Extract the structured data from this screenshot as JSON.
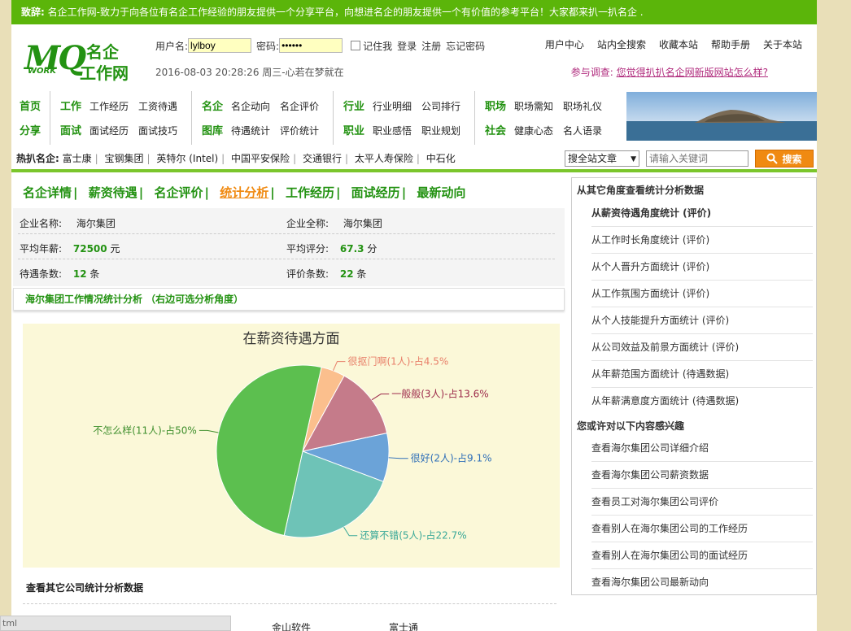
{
  "greeting": {
    "label": "致辞:",
    "text": " 名企工作网-致力于向各位有名企工作经验的朋友提供一个分享平台，向想进名企的朋友提供一个有价值的参考平台！大家都来扒一扒名企 ."
  },
  "logo": {
    "mq": "MQ",
    "work": "WORK",
    "cn1": "名企",
    "cn2": "工作网"
  },
  "login": {
    "user_label": "用户名:",
    "user_value": "lylboy",
    "pass_label": "密码:",
    "pass_value": "••••••",
    "remember": "记住我",
    "login": "登录",
    "register": "注册",
    "forgot": "忘记密码"
  },
  "datetime": "2016-08-03 20:28:26  周三-心若在梦就在",
  "topnav": [
    "用户中心",
    "站内全搜索",
    "收藏本站",
    "帮助手册",
    "关于本站"
  ],
  "survey": {
    "label": "参与调查:",
    "question": "您觉得扒扒名企网新版网站怎么样?"
  },
  "nav": {
    "g1": {
      "r1h": "首页",
      "r2h": "分享"
    },
    "g2": {
      "r1h": "工作",
      "r1": [
        "工作经历",
        "工资待遇"
      ],
      "r2h": "面试",
      "r2": [
        "面试经历",
        "面试技巧"
      ]
    },
    "g3": {
      "r1h": "名企",
      "r1": [
        "名企动向",
        "名企评价"
      ],
      "r2h": "图库",
      "r2": [
        "待遇统计",
        "评价统计"
      ]
    },
    "g4": {
      "r1h": "行业",
      "r1": [
        "行业明细",
        "公司排行"
      ],
      "r2h": "职业",
      "r2": [
        "职业感悟",
        "职业规划"
      ]
    },
    "g5": {
      "r1h": "职场",
      "r1": [
        "职场需知",
        "职场礼仪"
      ],
      "r2h": "社会",
      "r2": [
        "健康心态",
        "名人语录"
      ]
    }
  },
  "hot": {
    "label": "热扒名企:",
    "items": [
      "富士康",
      "宝钢集团",
      "英特尔 (Intel)",
      "中国平安保险",
      "交通银行",
      "太平人寿保险",
      "中石化"
    ]
  },
  "search": {
    "scope": "搜全站文章",
    "placeholder": "请输入关键词",
    "button": "搜索"
  },
  "tabs": [
    "名企详情",
    "薪资待遇",
    "名企评价",
    "统计分析",
    "工作经历",
    "面试经历",
    "最新动向"
  ],
  "info": {
    "name_label": "企业名称:",
    "name": "海尔集团",
    "full_label": "企业全称:",
    "full": "海尔集团",
    "salary_label": "平均年薪:",
    "salary": "72500",
    "salary_unit": "元",
    "score_label": "平均评分:",
    "score": "67.3",
    "score_unit": "分",
    "treat_label": "待遇条数:",
    "treat": "12",
    "treat_unit": "条",
    "eval_label": "评价条数:",
    "eval": "22",
    "eval_unit": "条"
  },
  "subtitle": "海尔集团工作情况统计分析 （右边可选分析角度）",
  "chart_data": {
    "type": "pie",
    "title": "在薪资待遇方面",
    "slices": [
      {
        "label": "很抠门啊(1人)-占4.5%",
        "value": 4.5,
        "color": "#fbbf8d"
      },
      {
        "label": "一般般(3人)-占13.6%",
        "value": 13.6,
        "color": "#c57b8a"
      },
      {
        "label": "很好(2人)-占9.1%",
        "value": 9.1,
        "color": "#6ba3d8"
      },
      {
        "label": "还算不错(5人)-占22.7%",
        "value": 22.7,
        "color": "#6ec3b7"
      },
      {
        "label": "不怎么样(11人)-占50%",
        "value": 50,
        "color": "#5cbf4f"
      }
    ],
    "label_colors": [
      "#e8806a",
      "#9c2a4a",
      "#2f6fb8",
      "#3aa898",
      "#3f8f2d"
    ]
  },
  "bottom": {
    "title": "查看其它公司统计分析数据",
    "links": [
      "金山软件",
      "富士通"
    ]
  },
  "side": {
    "h1": "从其它角度查看统计分析数据",
    "items1": [
      "从薪资待遇角度统计 (评价)",
      "从工作时长角度统计 (评价)",
      "从个人晋升方面统计 (评价)",
      "从工作氛围方面统计 (评价)",
      "从个人技能提升方面统计 (评价)",
      "从公司效益及前景方面统计 (评价)",
      "从年薪范围方面统计 (待遇数据)",
      "从年薪满意度方面统计 (待遇数据)"
    ],
    "h2": "您或许对以下内容感兴趣",
    "items2": [
      "查看海尔集团公司详细介绍",
      "查看海尔集团公司薪资数据",
      "查看员工对海尔集团公司评价",
      "查看别人在海尔集团公司的工作经历",
      "查看别人在海尔集团公司的面试经历",
      "查看海尔集团公司最新动向"
    ]
  },
  "statusbar": "tml"
}
